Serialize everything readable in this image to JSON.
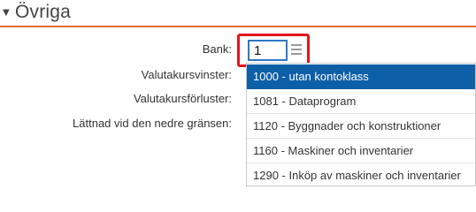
{
  "section": {
    "caret_icon": "triangle-down-icon",
    "title": "Övriga",
    "accent_color": "#ec6a2c"
  },
  "fields": {
    "bank_label": "Bank:",
    "bank_value": "1",
    "valutakursvinster_label": "Valutakursvinster:",
    "valutakursforluster_label": "Valutakursförluster:",
    "lattnad_label": "Lättnad vid den nedre gränsen:"
  },
  "dropdown": {
    "selected_color": "#0d5fa8",
    "items": [
      {
        "label": "1000 - utan kontoklass",
        "selected": true
      },
      {
        "label": "1081 - Dataprogram",
        "selected": false
      },
      {
        "label": "1120 - Byggnader och konstruktioner",
        "selected": false
      },
      {
        "label": "1160 - Maskiner och inventarier",
        "selected": false
      },
      {
        "label": "1290 - Inköp av maskiner och inventarier",
        "selected": false
      }
    ]
  }
}
